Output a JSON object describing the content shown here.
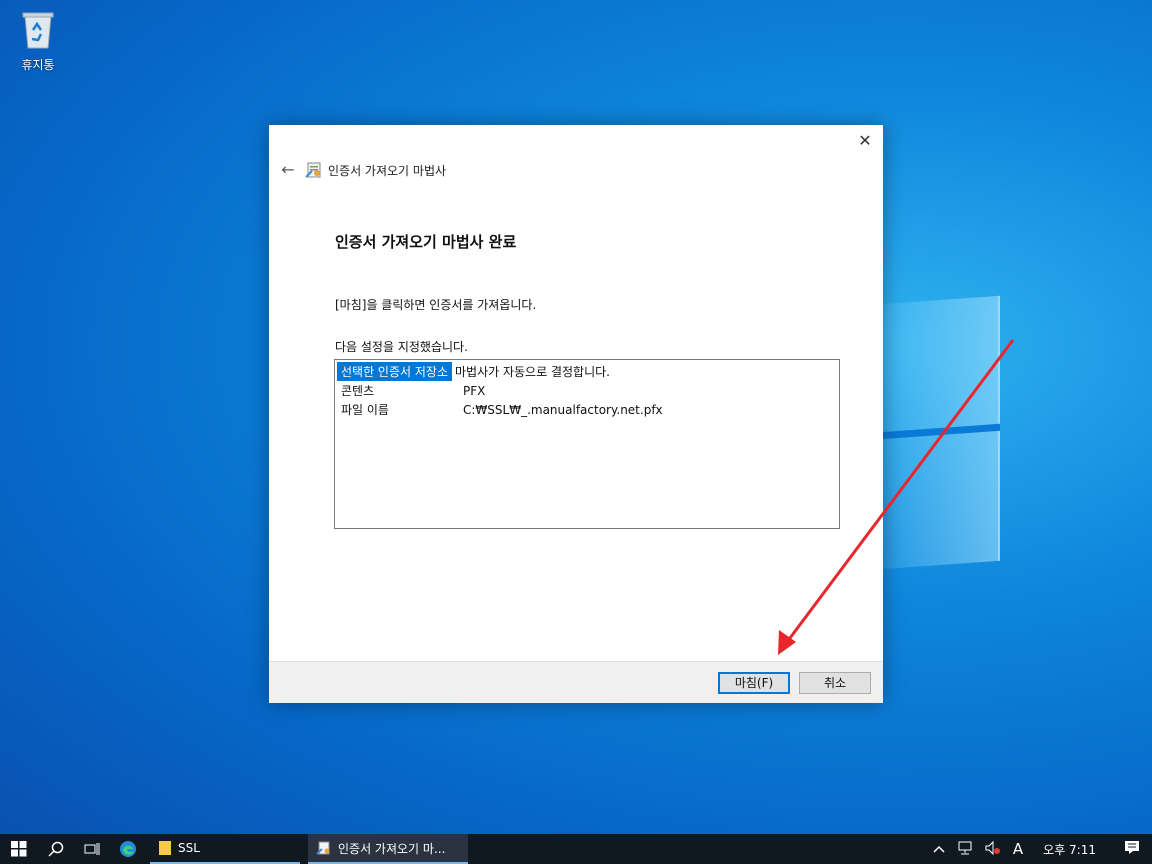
{
  "desktop": {
    "recycle_bin_label": "휴지통"
  },
  "dialog": {
    "wizard_title": "인증서 가져오기 마법사",
    "heading": "인증서 가져오기 마법사 완료",
    "intro_text": "[마침]을 클릭하면 인증서를 가져옵니다.",
    "settings_label": "다음 설정을 지정했습니다.",
    "settings": [
      {
        "key": "선택한 인증서 저장소",
        "value": "마법사가 자동으로 결정합니다."
      },
      {
        "key": "콘텐츠",
        "value": "PFX"
      },
      {
        "key": "파일 이름",
        "value": "C:₩SSL₩_.manualfactory.net.pfx"
      }
    ],
    "finish_label": "마침(F)",
    "cancel_label": "취소",
    "close_glyph": "✕",
    "back_glyph": "←"
  },
  "annotation": {
    "arrow_color": "#e8262b"
  },
  "taskbar": {
    "ssl_label": "SSL",
    "active_task_label": "인증서 가져오기 마...",
    "ime_label": "A",
    "clock": "오후 7:11"
  }
}
